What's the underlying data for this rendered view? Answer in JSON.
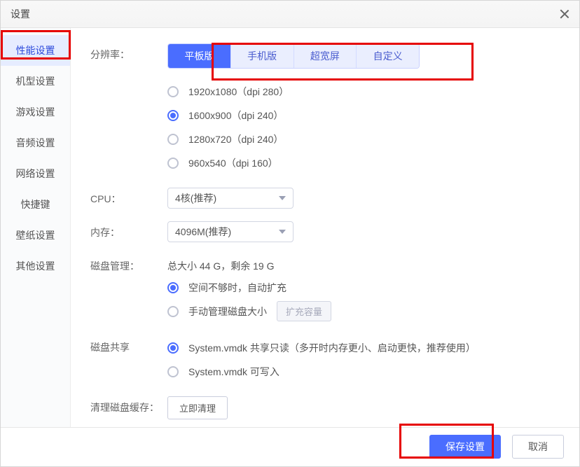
{
  "window": {
    "title": "设置"
  },
  "sidebar": {
    "items": [
      {
        "label": "性能设置",
        "active": true
      },
      {
        "label": "机型设置"
      },
      {
        "label": "游戏设置"
      },
      {
        "label": "音频设置"
      },
      {
        "label": "网络设置"
      },
      {
        "label": "快捷键"
      },
      {
        "label": "壁纸设置"
      },
      {
        "label": "其他设置"
      }
    ]
  },
  "sections": {
    "resolution": {
      "label": "分辨率：",
      "tabs": [
        {
          "label": "平板版",
          "active": true
        },
        {
          "label": "手机版"
        },
        {
          "label": "超宽屏"
        },
        {
          "label": "自定义"
        }
      ],
      "options": [
        {
          "label": "1920x1080（dpi 280）",
          "selected": false
        },
        {
          "label": "1600x900（dpi 240）",
          "selected": true
        },
        {
          "label": "1280x720（dpi 240）",
          "selected": false
        },
        {
          "label": "960x540（dpi 160）",
          "selected": false
        }
      ]
    },
    "cpu": {
      "label": "CPU：",
      "value": "4核(推荐)"
    },
    "memory": {
      "label": "内存：",
      "value": "4096M(推荐)"
    },
    "disk": {
      "label": "磁盘管理：",
      "summary": "总大小 44 G，剩余 19 G",
      "options": [
        {
          "label": "空间不够时，自动扩充",
          "selected": true
        },
        {
          "label": "手动管理磁盘大小",
          "selected": false
        }
      ],
      "expand_btn": "扩充容量"
    },
    "share": {
      "label": "磁盘共享",
      "options": [
        {
          "label": "System.vmdk 共享只读（多开时内存更小、启动更快，推荐使用）",
          "selected": true
        },
        {
          "label": "System.vmdk 可写入",
          "selected": false
        }
      ]
    },
    "clean": {
      "label": "清理磁盘缓存：",
      "button": "立即清理"
    }
  },
  "footer": {
    "save": "保存设置",
    "cancel": "取消"
  }
}
